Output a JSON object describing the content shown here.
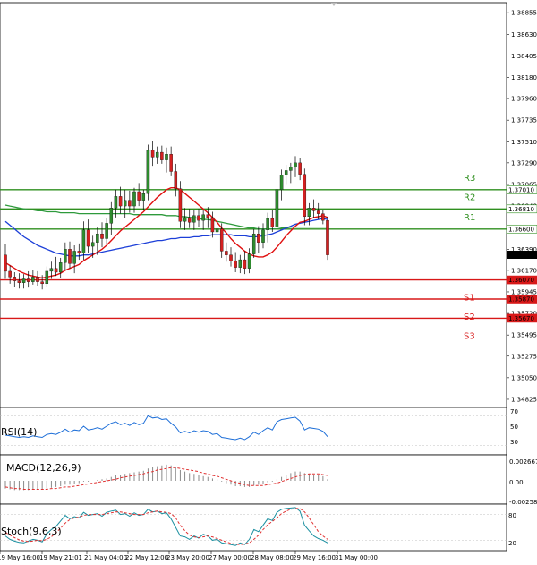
{
  "chart_data": [
    {
      "type": "candlestick",
      "colors": {
        "bull": "#2e8b2e",
        "bear": "#d42020",
        "wick": "#000000",
        "sma_fast": "#e01010",
        "sma_mid": "#1c3fd8",
        "sma_slow": "#2e9a3c",
        "resistance": "#2f8f1f",
        "support": "#d81818"
      },
      "y_axis": {
        "ticks": [
          "1.38855",
          "1.38630",
          "1.38405",
          "1.38180",
          "1.37960",
          "1.37735",
          "1.37510",
          "1.37290",
          "1.37065",
          "1.36840",
          "1.36615",
          "1.36390",
          "1.36170",
          "1.35945",
          "1.35720",
          "1.35495",
          "1.35275",
          "1.35050",
          "1.34825"
        ],
        "ylim": [
          1.3475,
          1.3895
        ]
      },
      "x_axis": {
        "ticks": [
          "19 May 16:00",
          "19 May 21:01",
          "21 May 04:00",
          "22 May 12:00",
          "23 May 20:00",
          "27 May 00:00",
          "28 May 08:00",
          "29 May 16:00",
          "31 May 00:00"
        ]
      },
      "candles": [
        [
          1.3633,
          1.3644,
          1.3608,
          1.3616
        ],
        [
          1.3616,
          1.3622,
          1.3603,
          1.361
        ],
        [
          1.361,
          1.3615,
          1.36,
          1.3606
        ],
        [
          1.3606,
          1.3614,
          1.3598,
          1.3604
        ],
        [
          1.3604,
          1.3613,
          1.3598,
          1.3608
        ],
        [
          1.3608,
          1.3616,
          1.3599,
          1.3605
        ],
        [
          1.3605,
          1.3617,
          1.3602,
          1.361
        ],
        [
          1.361,
          1.3616,
          1.3601,
          1.3605
        ],
        [
          1.3605,
          1.3612,
          1.3597,
          1.3603
        ],
        [
          1.3603,
          1.3621,
          1.36,
          1.3616
        ],
        [
          1.3616,
          1.3626,
          1.3608,
          1.3619
        ],
        [
          1.3619,
          1.3631,
          1.3611,
          1.3615
        ],
        [
          1.3615,
          1.363,
          1.3609,
          1.3625
        ],
        [
          1.3625,
          1.3646,
          1.3617,
          1.3639
        ],
        [
          1.3639,
          1.3647,
          1.3619,
          1.3624
        ],
        [
          1.3624,
          1.3643,
          1.3614,
          1.3637
        ],
        [
          1.3637,
          1.3645,
          1.3628,
          1.3635
        ],
        [
          1.3635,
          1.3668,
          1.3628,
          1.3659
        ],
        [
          1.3659,
          1.367,
          1.3635,
          1.3642
        ],
        [
          1.3642,
          1.3653,
          1.363,
          1.3646
        ],
        [
          1.3646,
          1.3662,
          1.3633,
          1.3655
        ],
        [
          1.3655,
          1.3667,
          1.3641,
          1.365
        ],
        [
          1.365,
          1.3671,
          1.3644,
          1.3666
        ],
        [
          1.3666,
          1.3688,
          1.3654,
          1.3682
        ],
        [
          1.3682,
          1.3701,
          1.3672,
          1.3694
        ],
        [
          1.3694,
          1.3704,
          1.3676,
          1.3684
        ],
        [
          1.3684,
          1.3701,
          1.3671,
          1.369
        ],
        [
          1.369,
          1.37,
          1.3677,
          1.3684
        ],
        [
          1.3684,
          1.3703,
          1.3677,
          1.3699
        ],
        [
          1.3699,
          1.3708,
          1.3684,
          1.369
        ],
        [
          1.369,
          1.3701,
          1.368,
          1.3697
        ],
        [
          1.3697,
          1.3748,
          1.369,
          1.3742
        ],
        [
          1.3742,
          1.3752,
          1.3726,
          1.3735
        ],
        [
          1.3735,
          1.3746,
          1.3728,
          1.374
        ],
        [
          1.374,
          1.3747,
          1.3728,
          1.3732
        ],
        [
          1.3732,
          1.3745,
          1.3719,
          1.3738
        ],
        [
          1.3738,
          1.3746,
          1.3715,
          1.372
        ],
        [
          1.372,
          1.3728,
          1.3694,
          1.3702
        ],
        [
          1.3702,
          1.371,
          1.3661,
          1.3668
        ],
        [
          1.3668,
          1.3682,
          1.3659,
          1.3672
        ],
        [
          1.3672,
          1.3681,
          1.3661,
          1.3667
        ],
        [
          1.3667,
          1.368,
          1.3659,
          1.3674
        ],
        [
          1.3674,
          1.3681,
          1.3662,
          1.3669
        ],
        [
          1.3669,
          1.368,
          1.3659,
          1.3675
        ],
        [
          1.3675,
          1.3683,
          1.3661,
          1.3672
        ],
        [
          1.3672,
          1.3678,
          1.3651,
          1.3657
        ],
        [
          1.3657,
          1.3668,
          1.365,
          1.366
        ],
        [
          1.366,
          1.3666,
          1.363,
          1.3637
        ],
        [
          1.3637,
          1.3646,
          1.3626,
          1.3633
        ],
        [
          1.3633,
          1.3641,
          1.3621,
          1.3627
        ],
        [
          1.3627,
          1.3636,
          1.3615,
          1.362
        ],
        [
          1.362,
          1.3633,
          1.3614,
          1.3628
        ],
        [
          1.3628,
          1.3637,
          1.3613,
          1.3619
        ],
        [
          1.3619,
          1.364,
          1.3614,
          1.3634
        ],
        [
          1.3634,
          1.366,
          1.363,
          1.3655
        ],
        [
          1.3655,
          1.3663,
          1.3635,
          1.3646
        ],
        [
          1.3646,
          1.3666,
          1.364,
          1.3659
        ],
        [
          1.3659,
          1.3677,
          1.3646,
          1.3671
        ],
        [
          1.3671,
          1.368,
          1.3657,
          1.3662
        ],
        [
          1.3662,
          1.3708,
          1.3656,
          1.3701
        ],
        [
          1.3701,
          1.3722,
          1.369,
          1.3716
        ],
        [
          1.3716,
          1.3727,
          1.3706,
          1.3721
        ],
        [
          1.3721,
          1.3729,
          1.3708,
          1.3725
        ],
        [
          1.3725,
          1.3736,
          1.3714,
          1.3729
        ],
        [
          1.3729,
          1.3734,
          1.3711,
          1.3717
        ],
        [
          1.3717,
          1.3723,
          1.3664,
          1.3673
        ],
        [
          1.3673,
          1.3687,
          1.3664,
          1.3682
        ],
        [
          1.3682,
          1.3691,
          1.3671,
          1.3679
        ],
        [
          1.3679,
          1.3687,
          1.367,
          1.3676
        ],
        [
          1.3676,
          1.368,
          1.3665,
          1.3669
        ],
        [
          1.3669,
          1.3673,
          1.3628,
          1.3633
        ]
      ],
      "moving_averages": {
        "fast": [
          1.3625,
          1.3622,
          1.3619,
          1.3616,
          1.3614,
          1.3612,
          1.3611,
          1.361,
          1.3609,
          1.361,
          1.3611,
          1.3612,
          1.3614,
          1.3617,
          1.3619,
          1.3621,
          1.3623,
          1.3627,
          1.363,
          1.3633,
          1.3636,
          1.3639,
          1.3643,
          1.3648,
          1.3653,
          1.3658,
          1.3662,
          1.3666,
          1.367,
          1.3674,
          1.3678,
          1.3683,
          1.3688,
          1.3693,
          1.3697,
          1.3701,
          1.3703,
          1.3703,
          1.3701,
          1.3697,
          1.3693,
          1.3689,
          1.3685,
          1.3681,
          1.3677,
          1.3672,
          1.3667,
          1.3661,
          1.3656,
          1.365,
          1.3645,
          1.3641,
          1.3637,
          1.3634,
          1.3632,
          1.3631,
          1.3631,
          1.3633,
          1.3636,
          1.3641,
          1.3647,
          1.3653,
          1.3658,
          1.3663,
          1.3667,
          1.3668,
          1.367,
          1.3672,
          1.3673,
          1.3674,
          1.3672
        ],
        "mid": [
          1.3668,
          1.3664,
          1.366,
          1.3656,
          1.3652,
          1.3649,
          1.3646,
          1.3643,
          1.3641,
          1.3639,
          1.3637,
          1.3635,
          1.3634,
          1.3633,
          1.3632,
          1.3632,
          1.3632,
          1.3633,
          1.3633,
          1.3634,
          1.3635,
          1.3636,
          1.3637,
          1.3638,
          1.3639,
          1.364,
          1.3641,
          1.3642,
          1.3643,
          1.3644,
          1.3645,
          1.3646,
          1.3647,
          1.3648,
          1.3648,
          1.3649,
          1.365,
          1.365,
          1.3651,
          1.3651,
          1.3651,
          1.3652,
          1.3652,
          1.3653,
          1.3653,
          1.3654,
          1.3654,
          1.3654,
          1.3654,
          1.3654,
          1.3653,
          1.3653,
          1.3653,
          1.3652,
          1.3652,
          1.3652,
          1.3653,
          1.3654,
          1.3655,
          1.3657,
          1.3659,
          1.3661,
          1.3663,
          1.3665,
          1.3666,
          1.3667,
          1.3668,
          1.3669,
          1.367,
          1.3671,
          1.367
        ],
        "slow": [
          1.3685,
          1.3684,
          1.3683,
          1.3682,
          1.3681,
          1.368,
          1.368,
          1.3679,
          1.3679,
          1.3678,
          1.3678,
          1.3678,
          1.3677,
          1.3677,
          1.3677,
          1.3677,
          1.3676,
          1.3676,
          1.3676,
          1.3676,
          1.3676,
          1.3676,
          1.3676,
          1.3676,
          1.3676,
          1.3676,
          1.3676,
          1.3676,
          1.3675,
          1.3675,
          1.3675,
          1.3675,
          1.3675,
          1.3675,
          1.3675,
          1.3674,
          1.3674,
          1.3674,
          1.3673,
          1.3673,
          1.3672,
          1.3672,
          1.3671,
          1.367,
          1.367,
          1.3669,
          1.3668,
          1.3667,
          1.3666,
          1.3665,
          1.3664,
          1.3663,
          1.3662,
          1.3661,
          1.3661,
          1.366,
          1.366,
          1.366,
          1.366,
          1.366,
          1.3661,
          1.3661,
          1.3662,
          1.3662,
          1.3662,
          1.3662,
          1.3662,
          1.3662,
          1.3662,
          1.3662,
          1.3662
        ]
      },
      "levels": [
        {
          "name": "R3",
          "value": 1.3701,
          "label": "1.37010",
          "kind": "resistance"
        },
        {
          "name": "R2",
          "value": 1.3681,
          "label": "1.36810",
          "kind": "resistance"
        },
        {
          "name": "R1",
          "value": 1.366,
          "label": "1.36600",
          "kind": "resistance"
        },
        {
          "name": "S1",
          "value": 1.3607,
          "label": "1.36070",
          "kind": "support"
        },
        {
          "name": "S2",
          "value": 1.3587,
          "label": "1.35870",
          "kind": "support"
        },
        {
          "name": "S3",
          "value": 1.3567,
          "label": "1.35670",
          "kind": "support"
        }
      ],
      "current_price": {
        "value": 1.36332,
        "label": "1.36332"
      }
    },
    {
      "type": "line",
      "title": "RSI(14)",
      "ticks": [
        "70",
        "50",
        "30"
      ],
      "ylim": [
        20,
        80
      ],
      "colors": {
        "line": "#1e6fd8"
      },
      "values": [
        44,
        43,
        42,
        41,
        42,
        41,
        43,
        42,
        41,
        45,
        46,
        45,
        48,
        52,
        48,
        51,
        50,
        56,
        51,
        52,
        54,
        52,
        56,
        60,
        62,
        58,
        60,
        57,
        61,
        58,
        60,
        70,
        67,
        68,
        65,
        66,
        60,
        55,
        47,
        49,
        47,
        50,
        48,
        50,
        49,
        45,
        46,
        41,
        40,
        39,
        38,
        40,
        38,
        42,
        48,
        45,
        50,
        54,
        51,
        62,
        65,
        66,
        67,
        68,
        63,
        51,
        54,
        53,
        52,
        49,
        42
      ]
    },
    {
      "type": "bar",
      "title": "MACD(12,26,9)",
      "ticks": [
        "0.002667",
        "0.00",
        "-0.002586"
      ],
      "ylim": [
        -0.0029,
        0.0029
      ],
      "colors": {
        "bar": "#8a8a8a",
        "signal": "#e03030"
      },
      "histogram": [
        -0.001,
        -0.0011,
        -0.0012,
        -0.0012,
        -0.0012,
        -0.0012,
        -0.0011,
        -0.0011,
        -0.0011,
        -0.001,
        -0.0009,
        -0.0008,
        -0.0007,
        -0.0005,
        -0.0005,
        -0.0004,
        -0.0003,
        -0.0001,
        -0.0001,
        0.0,
        0.0001,
        0.0002,
        0.0003,
        0.0005,
        0.0007,
        0.0008,
        0.0009,
        0.001,
        0.0011,
        0.0012,
        0.0013,
        0.0016,
        0.0018,
        0.0019,
        0.002,
        0.0021,
        0.002,
        0.0018,
        0.0014,
        0.0012,
        0.001,
        0.0009,
        0.0007,
        0.0006,
        0.0005,
        0.0003,
        0.0002,
        -0.0001,
        -0.0003,
        -0.0005,
        -0.0007,
        -0.0007,
        -0.0008,
        -0.0008,
        -0.0006,
        -0.0005,
        -0.0004,
        -0.0002,
        -0.0001,
        0.0002,
        0.0005,
        0.0008,
        0.001,
        0.0012,
        0.0012,
        0.001,
        0.0009,
        0.0008,
        0.0007,
        0.0006,
        0.0002
      ],
      "signal": [
        -0.0008,
        -0.0009,
        -0.001,
        -0.001,
        -0.0011,
        -0.0011,
        -0.0011,
        -0.0011,
        -0.0011,
        -0.0011,
        -0.001,
        -0.001,
        -0.0009,
        -0.0008,
        -0.0008,
        -0.0007,
        -0.0006,
        -0.0005,
        -0.0004,
        -0.0003,
        -0.0002,
        -0.0001,
        0.0,
        0.0001,
        0.0002,
        0.0004,
        0.0005,
        0.0006,
        0.0007,
        0.0008,
        0.0009,
        0.0011,
        0.0012,
        0.0014,
        0.0015,
        0.0016,
        0.0017,
        0.0017,
        0.0016,
        0.0015,
        0.0014,
        0.0013,
        0.0012,
        0.001,
        0.0009,
        0.0007,
        0.0006,
        0.0004,
        0.0002,
        0.0,
        -0.0002,
        -0.0003,
        -0.0005,
        -0.0006,
        -0.0006,
        -0.0006,
        -0.0006,
        -0.0005,
        -0.0004,
        -0.0003,
        -0.0001,
        0.0001,
        0.0003,
        0.0005,
        0.0007,
        0.0008,
        0.0009,
        0.0009,
        0.0009,
        0.0008,
        0.0007
      ]
    },
    {
      "type": "line",
      "title": "Stoch(9,6,3)",
      "ticks": [
        "80",
        "20"
      ],
      "ylim": [
        0,
        100
      ],
      "colors": {
        "k": "#1a8fa0",
        "d": "#e03030"
      },
      "k": [
        30,
        22,
        18,
        15,
        14,
        18,
        22,
        20,
        16,
        35,
        45,
        52,
        65,
        78,
        70,
        75,
        72,
        85,
        78,
        80,
        82,
        76,
        85,
        88,
        90,
        80,
        82,
        76,
        84,
        78,
        80,
        92,
        86,
        88,
        82,
        84,
        70,
        50,
        30,
        28,
        22,
        30,
        25,
        34,
        30,
        20,
        22,
        14,
        12,
        10,
        8,
        14,
        10,
        22,
        45,
        40,
        55,
        70,
        66,
        85,
        92,
        94,
        95,
        96,
        88,
        55,
        42,
        30,
        24,
        20,
        14
      ],
      "d": [
        38,
        32,
        26,
        21,
        18,
        17,
        18,
        20,
        19,
        22,
        28,
        38,
        48,
        60,
        68,
        72,
        74,
        78,
        80,
        80,
        80,
        80,
        82,
        84,
        86,
        86,
        84,
        82,
        80,
        80,
        80,
        84,
        86,
        88,
        86,
        85,
        82,
        72,
        55,
        42,
        32,
        28,
        26,
        28,
        30,
        28,
        24,
        20,
        16,
        13,
        11,
        10,
        11,
        14,
        22,
        32,
        45,
        56,
        64,
        72,
        82,
        88,
        92,
        94,
        94,
        86,
        72,
        56,
        40,
        30,
        22
      ]
    }
  ]
}
